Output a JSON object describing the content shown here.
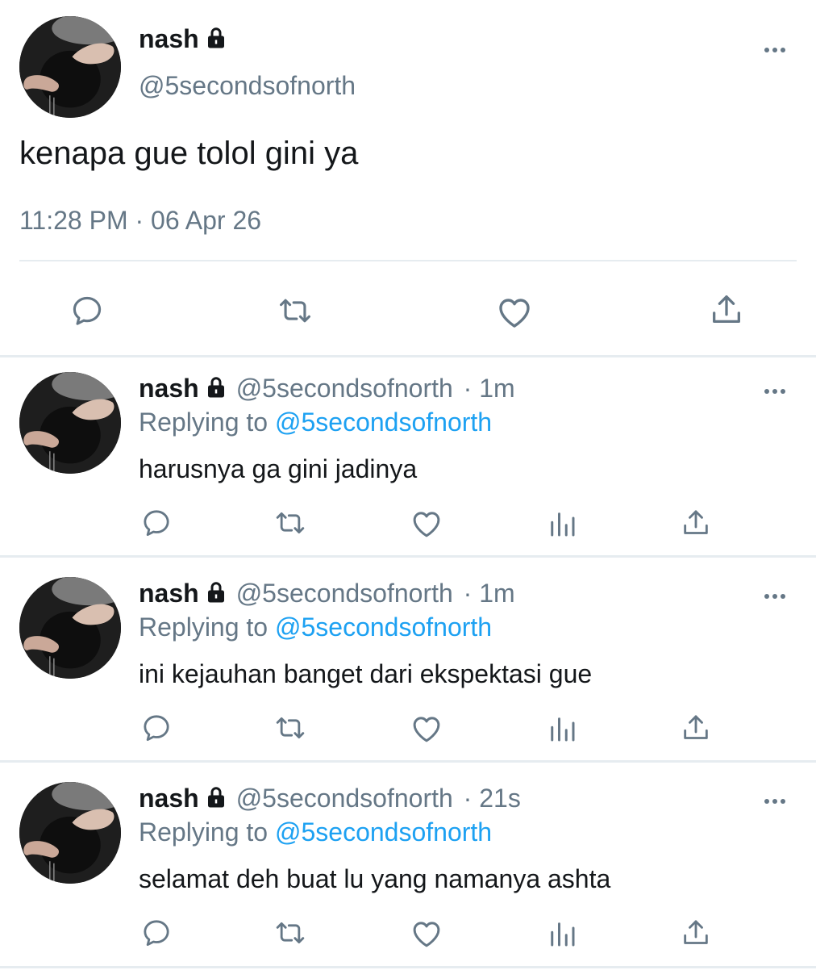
{
  "main_tweet": {
    "name": "nash",
    "handle": "@5secondsofnorth",
    "text": "kenapa gue tolol gini ya",
    "timestamp": "11:28 PM · 06 Apr 26",
    "icons": [
      "reply-icon",
      "retweet-icon",
      "like-icon",
      "share-icon"
    ]
  },
  "replies": [
    {
      "name": "nash",
      "handle": "@5secondsofnorth",
      "time": "· 1m",
      "replying_label": "Replying to",
      "replying_to": "@5secondsofnorth",
      "text": "harusnya ga gini jadinya"
    },
    {
      "name": "nash",
      "handle": "@5secondsofnorth",
      "time": "· 1m",
      "replying_label": "Replying to",
      "replying_to": "@5secondsofnorth",
      "text": "ini kejauhan banget dari ekspektasi gue"
    },
    {
      "name": "nash",
      "handle": "@5secondsofnorth",
      "time": "· 21s",
      "replying_label": "Replying to",
      "replying_to": "@5secondsofnorth",
      "text": "selamat deh buat lu yang namanya ashta"
    }
  ],
  "colors": {
    "text": "#14171a",
    "secondary": "#657786",
    "link": "#1da1f2",
    "divider": "#e6ecf0"
  }
}
